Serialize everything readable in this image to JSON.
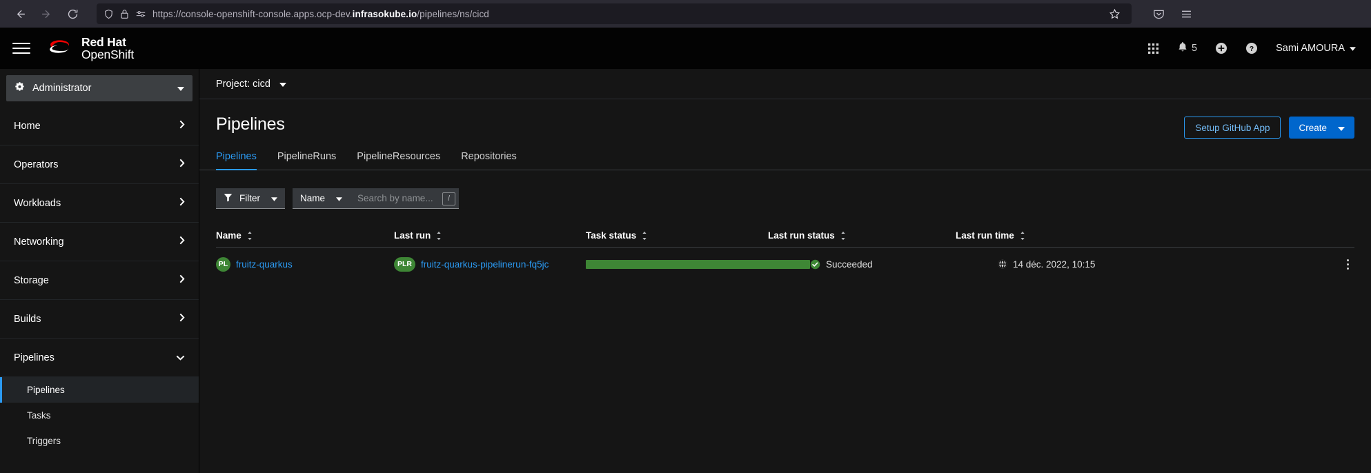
{
  "browser": {
    "url_prefix": "https://console-openshift-console.apps.ocp-dev.",
    "url_host": "infrasokube.io",
    "url_suffix": "/pipelines/ns/cicd",
    "back_icon": "back-arrow-icon",
    "forward_icon": "forward-arrow-icon",
    "reload_icon": "reload-icon",
    "shield_icon": "shield-icon",
    "lock_icon": "lock-icon",
    "permissions_icon": "page-permissions-icon",
    "bookmark_icon": "star-icon",
    "pocket_icon": "pocket-icon",
    "menu_icon": "hamburger-menu-icon"
  },
  "masthead": {
    "nav_toggle_icon": "hamburger-menu-icon",
    "brand_line1": "Red Hat",
    "brand_line2": "OpenShift",
    "app_launcher_icon": "grid-apps-icon",
    "notifications_icon": "bell-icon",
    "notifications_count": "5",
    "quick_add_icon": "plus-circle-icon",
    "help_icon": "question-circle-icon",
    "user_name": "Sami AMOURA",
    "user_caret_icon": "caret-down-icon"
  },
  "sidebar": {
    "perspective": "Administrator",
    "perspective_icon": "gears-icon",
    "perspective_caret_icon": "caret-down-icon",
    "items": [
      {
        "label": "Home",
        "chevron": "chevron-right-icon"
      },
      {
        "label": "Operators",
        "chevron": "chevron-right-icon"
      },
      {
        "label": "Workloads",
        "chevron": "chevron-right-icon"
      },
      {
        "label": "Networking",
        "chevron": "chevron-right-icon"
      },
      {
        "label": "Storage",
        "chevron": "chevron-right-icon"
      },
      {
        "label": "Builds",
        "chevron": "chevron-right-icon"
      },
      {
        "label": "Pipelines",
        "chevron": "chevron-down-icon"
      }
    ],
    "sub_items": [
      {
        "label": "Pipelines",
        "active": true
      },
      {
        "label": "Tasks",
        "active": false
      },
      {
        "label": "Triggers",
        "active": false
      }
    ]
  },
  "project_bar": {
    "label": "Project: cicd",
    "caret_icon": "caret-down-icon"
  },
  "page": {
    "title": "Pipelines",
    "setup_github_label": "Setup GitHub App",
    "create_label": "Create",
    "create_caret_icon": "caret-down-icon"
  },
  "tabs": [
    {
      "label": "Pipelines",
      "active": true
    },
    {
      "label": "PipelineRuns",
      "active": false
    },
    {
      "label": "PipelineResources",
      "active": false
    },
    {
      "label": "Repositories",
      "active": false
    }
  ],
  "toolbar": {
    "filter_label": "Filter",
    "filter_icon": "funnel-filter-icon",
    "filter_caret_icon": "caret-down-icon",
    "attribute_label": "Name",
    "attribute_caret_icon": "caret-down-icon",
    "search_placeholder": "Search by name...",
    "search_value": "",
    "search_shortcut": "/"
  },
  "table": {
    "columns": [
      {
        "label": "Name",
        "sort_icon": "sort-icon"
      },
      {
        "label": "Last run",
        "sort_icon": "sort-icon"
      },
      {
        "label": "Task status",
        "sort_icon": "sort-icon"
      },
      {
        "label": "Last run status",
        "sort_icon": "sort-icon"
      },
      {
        "label": "Last run time",
        "sort_icon": "sort-icon"
      }
    ],
    "rows": [
      {
        "name_badge": "PL",
        "name": "fruitz-quarkus",
        "lastrun_badge": "PLR",
        "lastrun": "fruitz-quarkus-pipelinerun-fq5jc",
        "task_status_percent": "100",
        "last_run_status": "Succeeded",
        "last_run_status_icon": "check-circle-icon",
        "last_run_time": "14 déc. 2022, 10:15",
        "last_run_time_icon": "globe-icon",
        "kebab_icon": "kebab-vertical-icon"
      }
    ]
  },
  "colors": {
    "accent_blue": "#2b9af3",
    "primary_button": "#0066cc",
    "success_green": "#3e8635",
    "brand_red": "#e00"
  }
}
